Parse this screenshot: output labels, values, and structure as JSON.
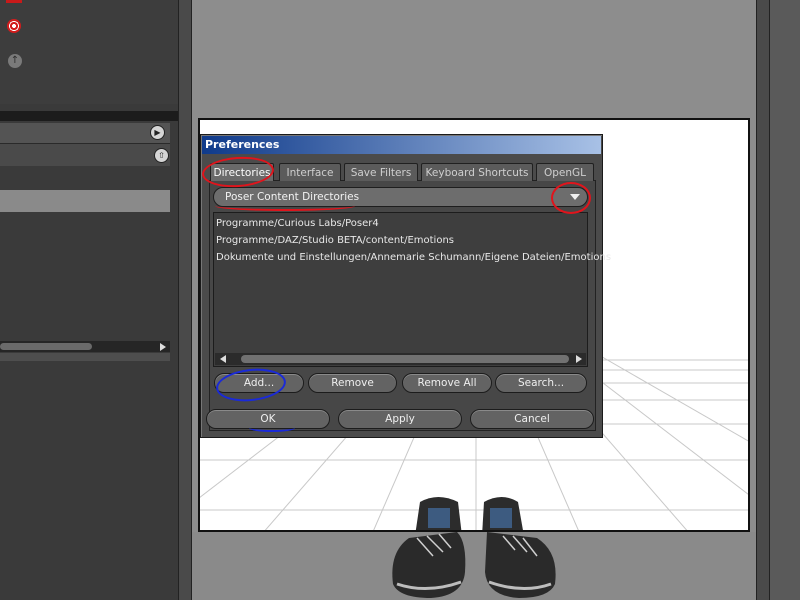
{
  "dialog": {
    "title": "Preferences",
    "tabs": [
      "Directories",
      "Interface",
      "Save Filters",
      "Keyboard Shortcuts",
      "OpenGL"
    ],
    "active_tab": "Directories",
    "directory_type": "Poser Content Directories",
    "directories": [
      "Programme/Curious Labs/Poser4",
      "Programme/DAZ/Studio BETA/content/Emotions",
      "Dokumente und Einstellungen/Annemarie Schumann/Eigene Dateien/Emotions"
    ],
    "list_buttons": {
      "add": "Add...",
      "remove": "Remove",
      "remove_all": "Remove All",
      "search": "Search..."
    },
    "footer_buttons": {
      "ok": "OK",
      "apply": "Apply",
      "cancel": "Cancel"
    }
  },
  "annotation_colors": {
    "red": "#e0141c",
    "blue": "#1a2ad8"
  },
  "colors": {
    "title_bar_start": "#0f3a8a",
    "title_bar_end": "#a8c1e6",
    "viewport": "#ffffff"
  }
}
